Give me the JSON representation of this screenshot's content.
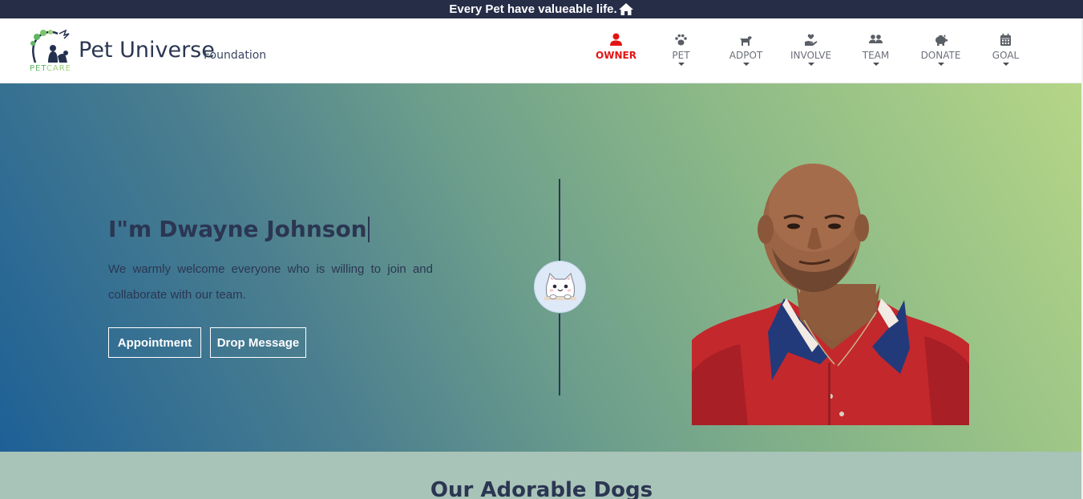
{
  "topbar": {
    "message": "Every Pet have valueable life.",
    "icon": "home-icon"
  },
  "header": {
    "logo_text_a": "PET",
    "logo_text_b": "CARE",
    "brand": "Pet Universe",
    "brand_sub": "Foundation"
  },
  "nav": {
    "owner": "OWNER",
    "pet": "PET",
    "adpot": "ADPOT",
    "involve": "INVOLVE",
    "team": "TEAM",
    "donate": "DONATE",
    "goal": "GOAL",
    "active_color": "#e31414"
  },
  "hero": {
    "title_prefix": "I\"m",
    "title_name": "Dwayne Johnson",
    "description": "We warmly welcome everyone who is willing to join and collaborate with our team.",
    "appointment_label": "Appointment",
    "message_label": "Drop Message"
  },
  "section": {
    "title": "Our Adorable Dogs"
  }
}
